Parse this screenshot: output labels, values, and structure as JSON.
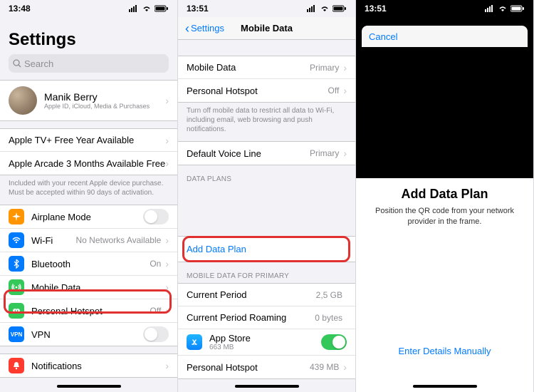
{
  "screen1": {
    "time": "13:48",
    "title": "Settings",
    "search_placeholder": "Search",
    "profile": {
      "name": "Manik Berry",
      "sub": "Apple ID, iCloud, Media & Purchases"
    },
    "promo1": "Apple TV+ Free Year Available",
    "promo2": "Apple Arcade 3 Months Available Free",
    "promo_footer": "Included with your recent Apple device purchase. Must be accepted within 90 days of activation.",
    "rows": {
      "airplane": "Airplane Mode",
      "wifi": "Wi-Fi",
      "wifi_detail": "No Networks Available",
      "bluetooth": "Bluetooth",
      "bluetooth_detail": "On",
      "mobile_data": "Mobile Data",
      "hotspot": "Personal Hotspot",
      "hotspot_detail": "Off",
      "vpn": "VPN",
      "notifications": "Notifications"
    }
  },
  "screen2": {
    "time": "13:51",
    "back": "Settings",
    "title": "Mobile Data",
    "rows": {
      "mobile_data": "Mobile Data",
      "mobile_data_detail": "Primary",
      "hotspot": "Personal Hotspot",
      "hotspot_detail": "Off"
    },
    "note": "Turn off mobile data to restrict all data to Wi-Fi, including email, web browsing and push notifications.",
    "default_voice": "Default Voice Line",
    "default_voice_detail": "Primary",
    "hdr_plans": "DATA PLANS",
    "add_plan": "Add Data Plan",
    "hdr_primary": "MOBILE DATA FOR PRIMARY",
    "current_period": "Current Period",
    "current_period_val": "2,5 GB",
    "roaming": "Current Period Roaming",
    "roaming_val": "0 bytes",
    "app_store": "App Store",
    "app_store_sub": "663 MB",
    "hotspot2": "Personal Hotspot",
    "hotspot2_val": "439 MB"
  },
  "screen3": {
    "time": "13:51",
    "cancel": "Cancel",
    "title": "Add Data Plan",
    "sub": "Position the QR code from your network provider in the frame.",
    "manual": "Enter Details Manually"
  }
}
